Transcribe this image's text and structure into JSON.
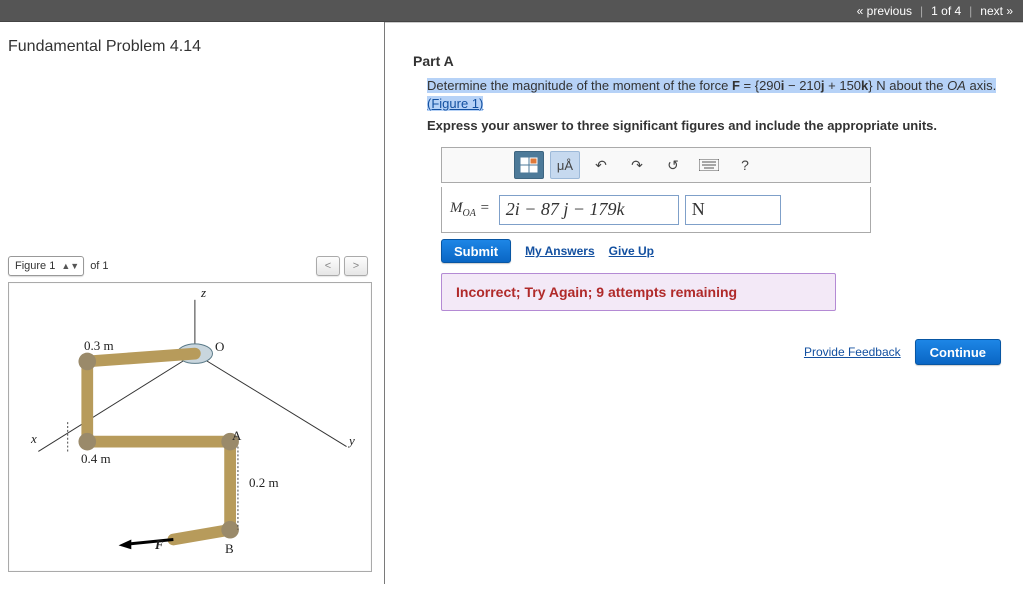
{
  "nav": {
    "prev": "« previous",
    "counter": "1 of 4",
    "next": "next »"
  },
  "problem": {
    "title": "Fundamental Problem 4.14"
  },
  "figure": {
    "selector_label": "Figure 1",
    "of_label": "of 1",
    "labels": {
      "z": "z",
      "x": "x",
      "y": "y",
      "O": "O",
      "A": "A",
      "B": "B",
      "F": "F",
      "d1": "0.3 m",
      "d2": "0.4 m",
      "d3": "0.2 m"
    }
  },
  "partA": {
    "heading": "Part A",
    "prompt_pre": "Determine the magnitude of the moment of the force ",
    "vec": "F",
    "equals": " = {290",
    "i": "i",
    "minus": "  −  210",
    "j": "j",
    "plus": "  +  150",
    "k": "k",
    "post": "} N  about the ",
    "axis": "OA",
    "post2": " axis. ",
    "figlink": "(Figure 1)",
    "instruction": "Express your answer to three significant figures and include the appropriate units.",
    "toolbar": {
      "unitbtn": "μÅ",
      "help": "?"
    },
    "answer": {
      "lhs": "M",
      "sub": "OA",
      "eq": " = ",
      "value": "2i − 87 j − 179k",
      "unit": "N"
    },
    "buttons": {
      "submit": "Submit",
      "my_answers": "My Answers",
      "give_up": "Give Up"
    },
    "feedback": "Incorrect; Try Again; 9 attempts remaining"
  },
  "footer": {
    "provide_feedback": "Provide Feedback",
    "continue": "Continue"
  }
}
